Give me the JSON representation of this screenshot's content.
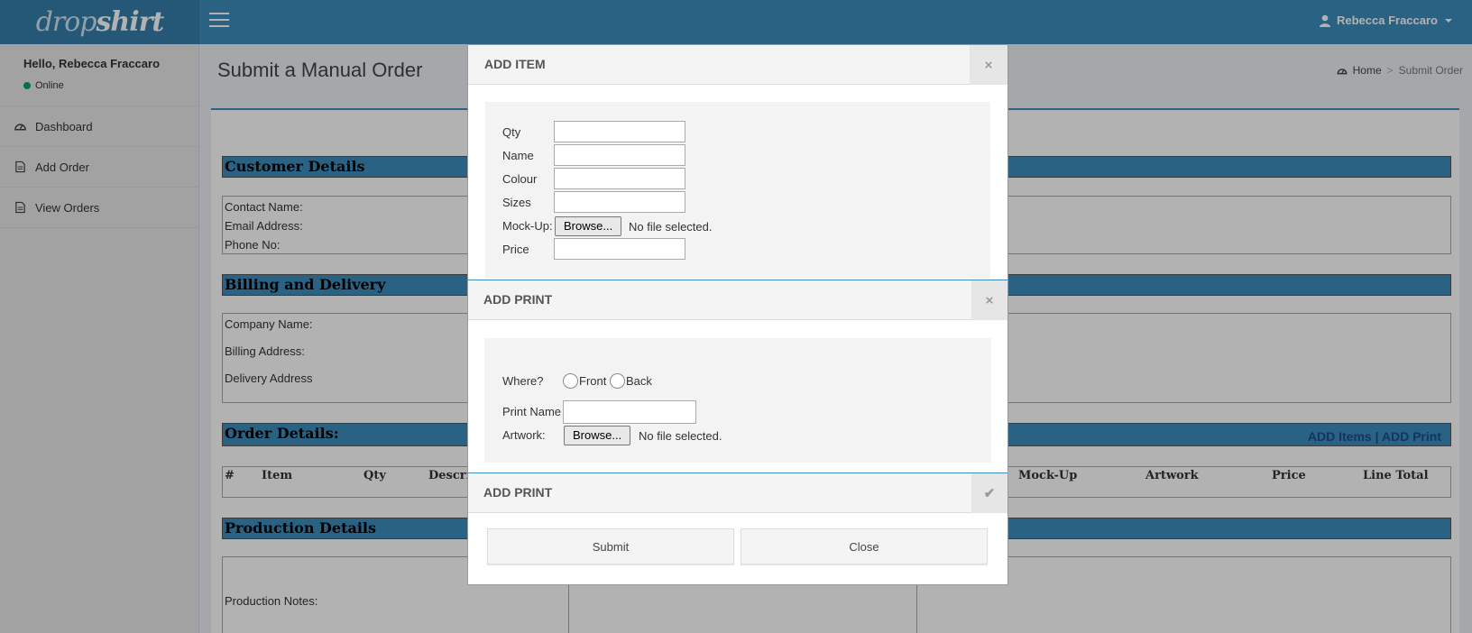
{
  "brand": {
    "light": "drop",
    "bold": "shirt"
  },
  "user": {
    "name": "Rebecca Fraccaro"
  },
  "sidebar": {
    "hello": "Hello, Rebecca Fraccaro",
    "status": "Online",
    "items": [
      {
        "label": "Dashboard",
        "icon": "dashboard-icon"
      },
      {
        "label": "Add Order",
        "icon": "file-icon"
      },
      {
        "label": "View Orders",
        "icon": "file-icon"
      }
    ]
  },
  "header": {
    "title": "Submit a Manual Order",
    "breadcrumb_home": "Home",
    "breadcrumb_current": "Submit Order"
  },
  "form": {
    "customer_title": "Customer Details",
    "contact_name": "Contact Name:",
    "email": "Email Address:",
    "phone": "Phone No:",
    "billing_title": "Billing and Delivery",
    "company": "Company Name:",
    "billing_address": "Billing Address:",
    "delivery_address": "Delivery Address",
    "order_title": "Order Details:",
    "add_items": "ADD Items",
    "link_sep": "|",
    "add_print": "ADD Print",
    "columns": [
      "#",
      "Item",
      "Qty",
      "Descri",
      "Mock-Up",
      "Artwork",
      "Price",
      "Line Total"
    ],
    "production_title": "Production Details",
    "production_notes": "Production Notes:"
  },
  "modal": {
    "add_item": {
      "title": "ADD ITEM",
      "close": "×",
      "qty": "Qty",
      "name": "Name",
      "colour": "Colour",
      "sizes": "Sizes",
      "mockup": "Mock-Up:",
      "browse": "Browse...",
      "no_file": "No file selected.",
      "price": "Price"
    },
    "add_print": {
      "title": "ADD PRINT",
      "close": "×",
      "where": "Where?",
      "front": "Front",
      "back": "Back",
      "print_name": "Print Name",
      "artwork": "Artwork:",
      "browse": "Browse...",
      "no_file": "No file selected."
    },
    "add_print_2": {
      "title": "ADD PRINT",
      "check": "✔"
    },
    "submit": "Submit",
    "close_btn": "Close"
  }
}
